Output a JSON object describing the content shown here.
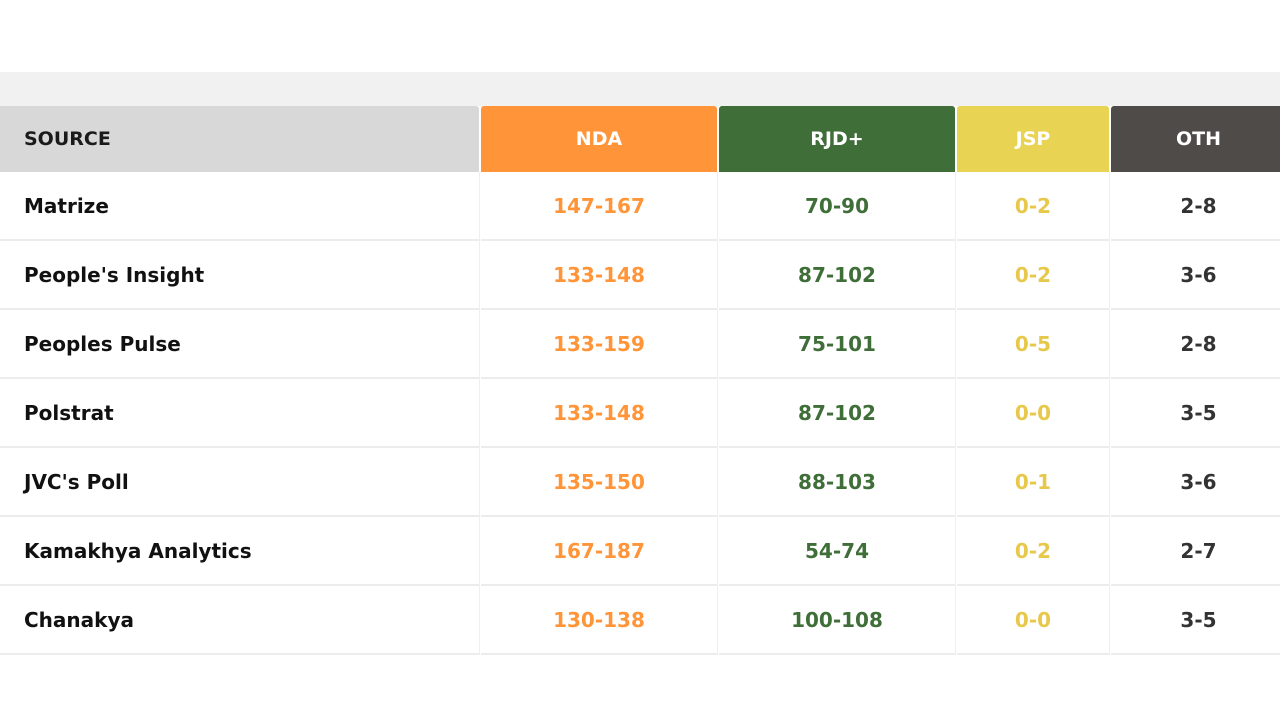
{
  "colors": {
    "nda": "#ff9538",
    "rjd": "#3f6e39",
    "jsp": "#e8d352",
    "oth": "#4e4b48",
    "nda_text": "#ff9538",
    "rjd_text": "#3f6e39",
    "jsp_text": "#e8c84a",
    "oth_text": "#333333"
  },
  "table": {
    "headers": {
      "source": "SOURCE",
      "nda": "NDA",
      "rjd": "RJD+",
      "jsp": "JSP",
      "oth": "OTH"
    },
    "rows": [
      {
        "source": "Matrize",
        "nda": "147-167",
        "rjd": "70-90",
        "jsp": "0-2",
        "oth": "2-8"
      },
      {
        "source": "People's Insight",
        "nda": "133-148",
        "rjd": "87-102",
        "jsp": "0-2",
        "oth": "3-6"
      },
      {
        "source": "Peoples Pulse",
        "nda": "133-159",
        "rjd": "75-101",
        "jsp": "0-5",
        "oth": "2-8"
      },
      {
        "source": "Polstrat",
        "nda": "133-148",
        "rjd": "87-102",
        "jsp": "0-0",
        "oth": "3-5"
      },
      {
        "source": "JVC's Poll",
        "nda": "135-150",
        "rjd": "88-103",
        "jsp": "0-1",
        "oth": "3-6"
      },
      {
        "source": "Kamakhya Analytics",
        "nda": "167-187",
        "rjd": "54-74",
        "jsp": "0-2",
        "oth": "2-7"
      },
      {
        "source": "Chanakya",
        "nda": "130-138",
        "rjd": "100-108",
        "jsp": "0-0",
        "oth": "3-5"
      }
    ]
  }
}
